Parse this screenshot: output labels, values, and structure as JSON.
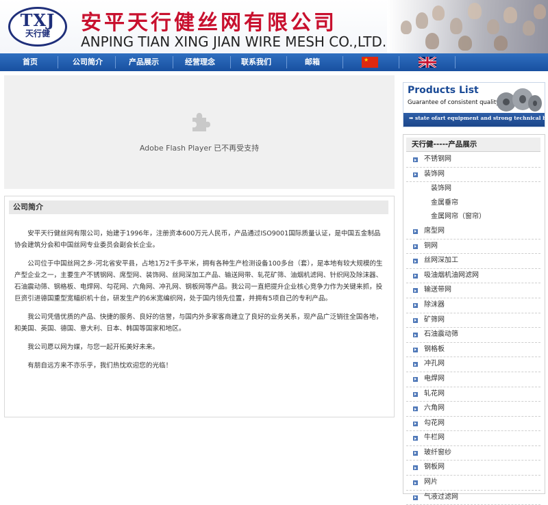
{
  "header": {
    "logo_top": "TXJ",
    "logo_bottom": "天行健",
    "company_cn": "安平天行健丝网有限公司",
    "company_en": "ANPING TIAN XING JIAN WIRE MESH CO.,LTD."
  },
  "nav": {
    "items": [
      {
        "label": "首页"
      },
      {
        "label": "公司简介"
      },
      {
        "label": "产品展示"
      },
      {
        "label": "经营理念"
      },
      {
        "label": "联系我们"
      },
      {
        "label": "邮箱"
      }
    ],
    "flags": [
      "china-flag-icon",
      "uk-flag-icon"
    ]
  },
  "flash": {
    "message": "Adobe Flash Player 已不再受支持",
    "icon": "puzzle-piece-icon"
  },
  "intro": {
    "title": "公司简介",
    "paragraphs": [
      "安平天行健丝网有限公司，始建于1996年，注册资本600万元人民币，产品通过ISO9001国际质量认证，是中国五金制品协会建筑分会和中国丝网专业委员会副会长企业。",
      "公司位于中国丝网之乡-河北省安平县，占地1万2千多平米，拥有各种生产检测设备100多台（套），是本地有较大规模的生产型企业之一，主要生产不锈钢网、席型网、装饰网、丝网深加工产品、输送网带、轧花矿筛、油烟机滤网、针织网及除沫器、石油震动筛、钢格板、电焊网、勾花网、六角网、冲孔网、钢板网等产品。我公司一直把提升企业核心竞争力作为关键来抓，投巨资引进德国重型宽幅织机十台，研发生产的6米宽编织网，处于国内领先位置，并拥有5项自己的专利产品。",
      "我公司凭借优质的产品、快捷的服务、良好的信誉，与国内外多家客商建立了良好的业务关系，现产品广泛销往全国各地，和美国、英国、德国、意大利、日本、韩国等国家和地区。",
      "我公司愿以网为媒，与您一起开拓美好未来。",
      "有朋自远方来不亦乐乎，我们热忱欢迎您的光临！"
    ]
  },
  "products_banner": {
    "title": "Products List",
    "subtitle": "Guarantee of consistent quality!!!",
    "tagline": "state ofart equipment and strong technical backup"
  },
  "categories": {
    "title": "天行健-----产品展示",
    "items": [
      {
        "label": "不锈钢网",
        "sub": false
      },
      {
        "label": "装饰网",
        "sub": false
      },
      {
        "label": "装饰网",
        "sub": true
      },
      {
        "label": "金属垂帘",
        "sub": true
      },
      {
        "label": "金属网帘（窗帘）",
        "sub": true
      },
      {
        "label": "席型网",
        "sub": false
      },
      {
        "label": "铜网",
        "sub": false
      },
      {
        "label": "丝网深加工",
        "sub": false
      },
      {
        "label": "吸油烟机油网滤网",
        "sub": false
      },
      {
        "label": "输送带网",
        "sub": false
      },
      {
        "label": "除沫器",
        "sub": false
      },
      {
        "label": "矿筛网",
        "sub": false
      },
      {
        "label": "石油震动筛",
        "sub": false
      },
      {
        "label": "钢格板",
        "sub": false
      },
      {
        "label": "冲孔网",
        "sub": false
      },
      {
        "label": "电焊网",
        "sub": false
      },
      {
        "label": "轧花网",
        "sub": false
      },
      {
        "label": "六角网",
        "sub": false
      },
      {
        "label": "勾花网",
        "sub": false
      },
      {
        "label": "牛栏网",
        "sub": false
      },
      {
        "label": "玻纤窗纱",
        "sub": false
      },
      {
        "label": "钢板网",
        "sub": false
      },
      {
        "label": "网片",
        "sub": false
      },
      {
        "label": "气液过滤网",
        "sub": false
      }
    ]
  }
}
